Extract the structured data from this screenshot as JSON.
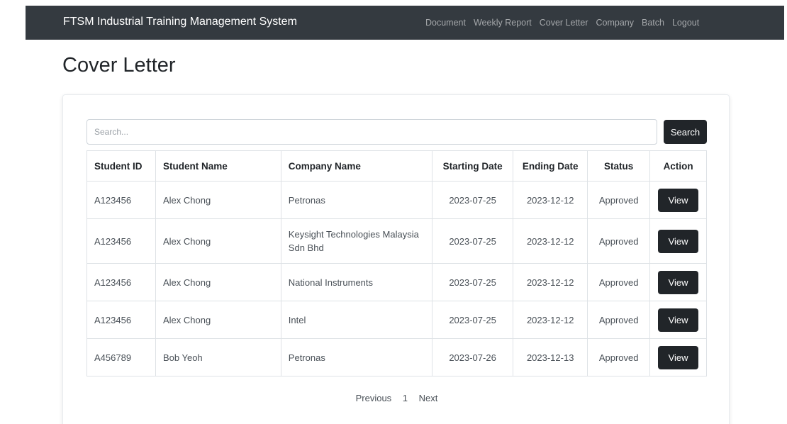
{
  "navbar": {
    "brand": "FTSM Industrial Training Management System",
    "links": [
      "Document",
      "Weekly Report",
      "Cover Letter",
      "Company",
      "Batch",
      "Logout"
    ]
  },
  "page": {
    "title": "Cover Letter"
  },
  "search": {
    "placeholder": "Search...",
    "button_label": "Search"
  },
  "table": {
    "headers": [
      "Student ID",
      "Student Name",
      "Company Name",
      "Starting Date",
      "Ending Date",
      "Status",
      "Action"
    ],
    "rows": [
      {
        "id": "A123456",
        "name": "Alex Chong",
        "company": "Petronas",
        "start": "2023-07-25",
        "end": "2023-12-12",
        "status": "Approved",
        "action": "View"
      },
      {
        "id": "A123456",
        "name": "Alex Chong",
        "company": "Keysight Technologies Malaysia Sdn Bhd",
        "start": "2023-07-25",
        "end": "2023-12-12",
        "status": "Approved",
        "action": "View"
      },
      {
        "id": "A123456",
        "name": "Alex Chong",
        "company": "National Instruments",
        "start": "2023-07-25",
        "end": "2023-12-12",
        "status": "Approved",
        "action": "View"
      },
      {
        "id": "A123456",
        "name": "Alex Chong",
        "company": "Intel",
        "start": "2023-07-25",
        "end": "2023-12-12",
        "status": "Approved",
        "action": "View"
      },
      {
        "id": "A456789",
        "name": "Bob Yeoh",
        "company": "Petronas",
        "start": "2023-07-26",
        "end": "2023-12-13",
        "status": "Approved",
        "action": "View"
      }
    ]
  },
  "pagination": {
    "previous": "Previous",
    "current": "1",
    "next": "Next"
  },
  "colors": {
    "navbar_bg": "#343a40",
    "button_bg": "#212529",
    "border": "#dee2e6"
  }
}
